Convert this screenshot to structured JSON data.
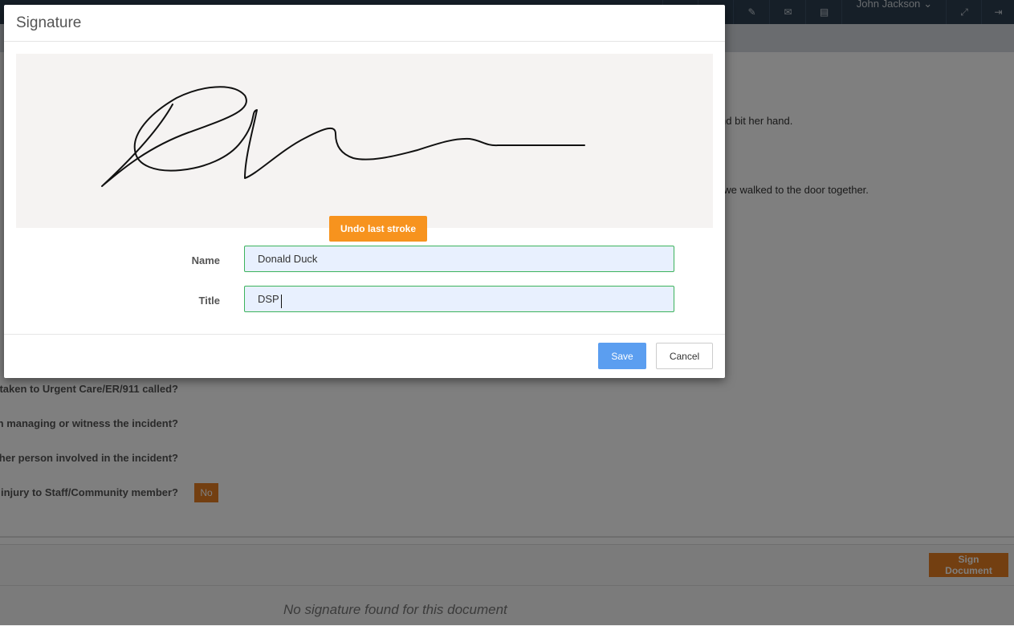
{
  "topbar": {
    "user_name": "John Jackson",
    "user_caret": "⌄",
    "icons": [
      "⬇",
      "△",
      "✎",
      "✉",
      "▤",
      "⤢",
      "⇥"
    ]
  },
  "page": {
    "paragraph_1_fragment": "nd bit her hand.",
    "paragraph_2_fragment": "I we walked to the door together.",
    "questions": [
      " taken to Urgent Care/ER/911 called?",
      " in managing or witness the incident?",
      "other person involved in the incident?",
      "/ injury to Staff/Community member?"
    ],
    "injury_answer": "No",
    "sign_document_label": "Sign Document",
    "no_signature_text": "No signature found for this document"
  },
  "modal": {
    "title": "Signature",
    "undo_label": "Undo last stroke",
    "name_label": "Name",
    "name_value": "Donald Duck",
    "title_label": "Title",
    "title_value": "DSP",
    "save_label": "Save",
    "cancel_label": "Cancel"
  },
  "colors": {
    "accent_orange": "#f7931e",
    "save_blue": "#5b9ef0",
    "input_border_green": "#3cb35c",
    "topbar_dark": "#2c3e50"
  }
}
